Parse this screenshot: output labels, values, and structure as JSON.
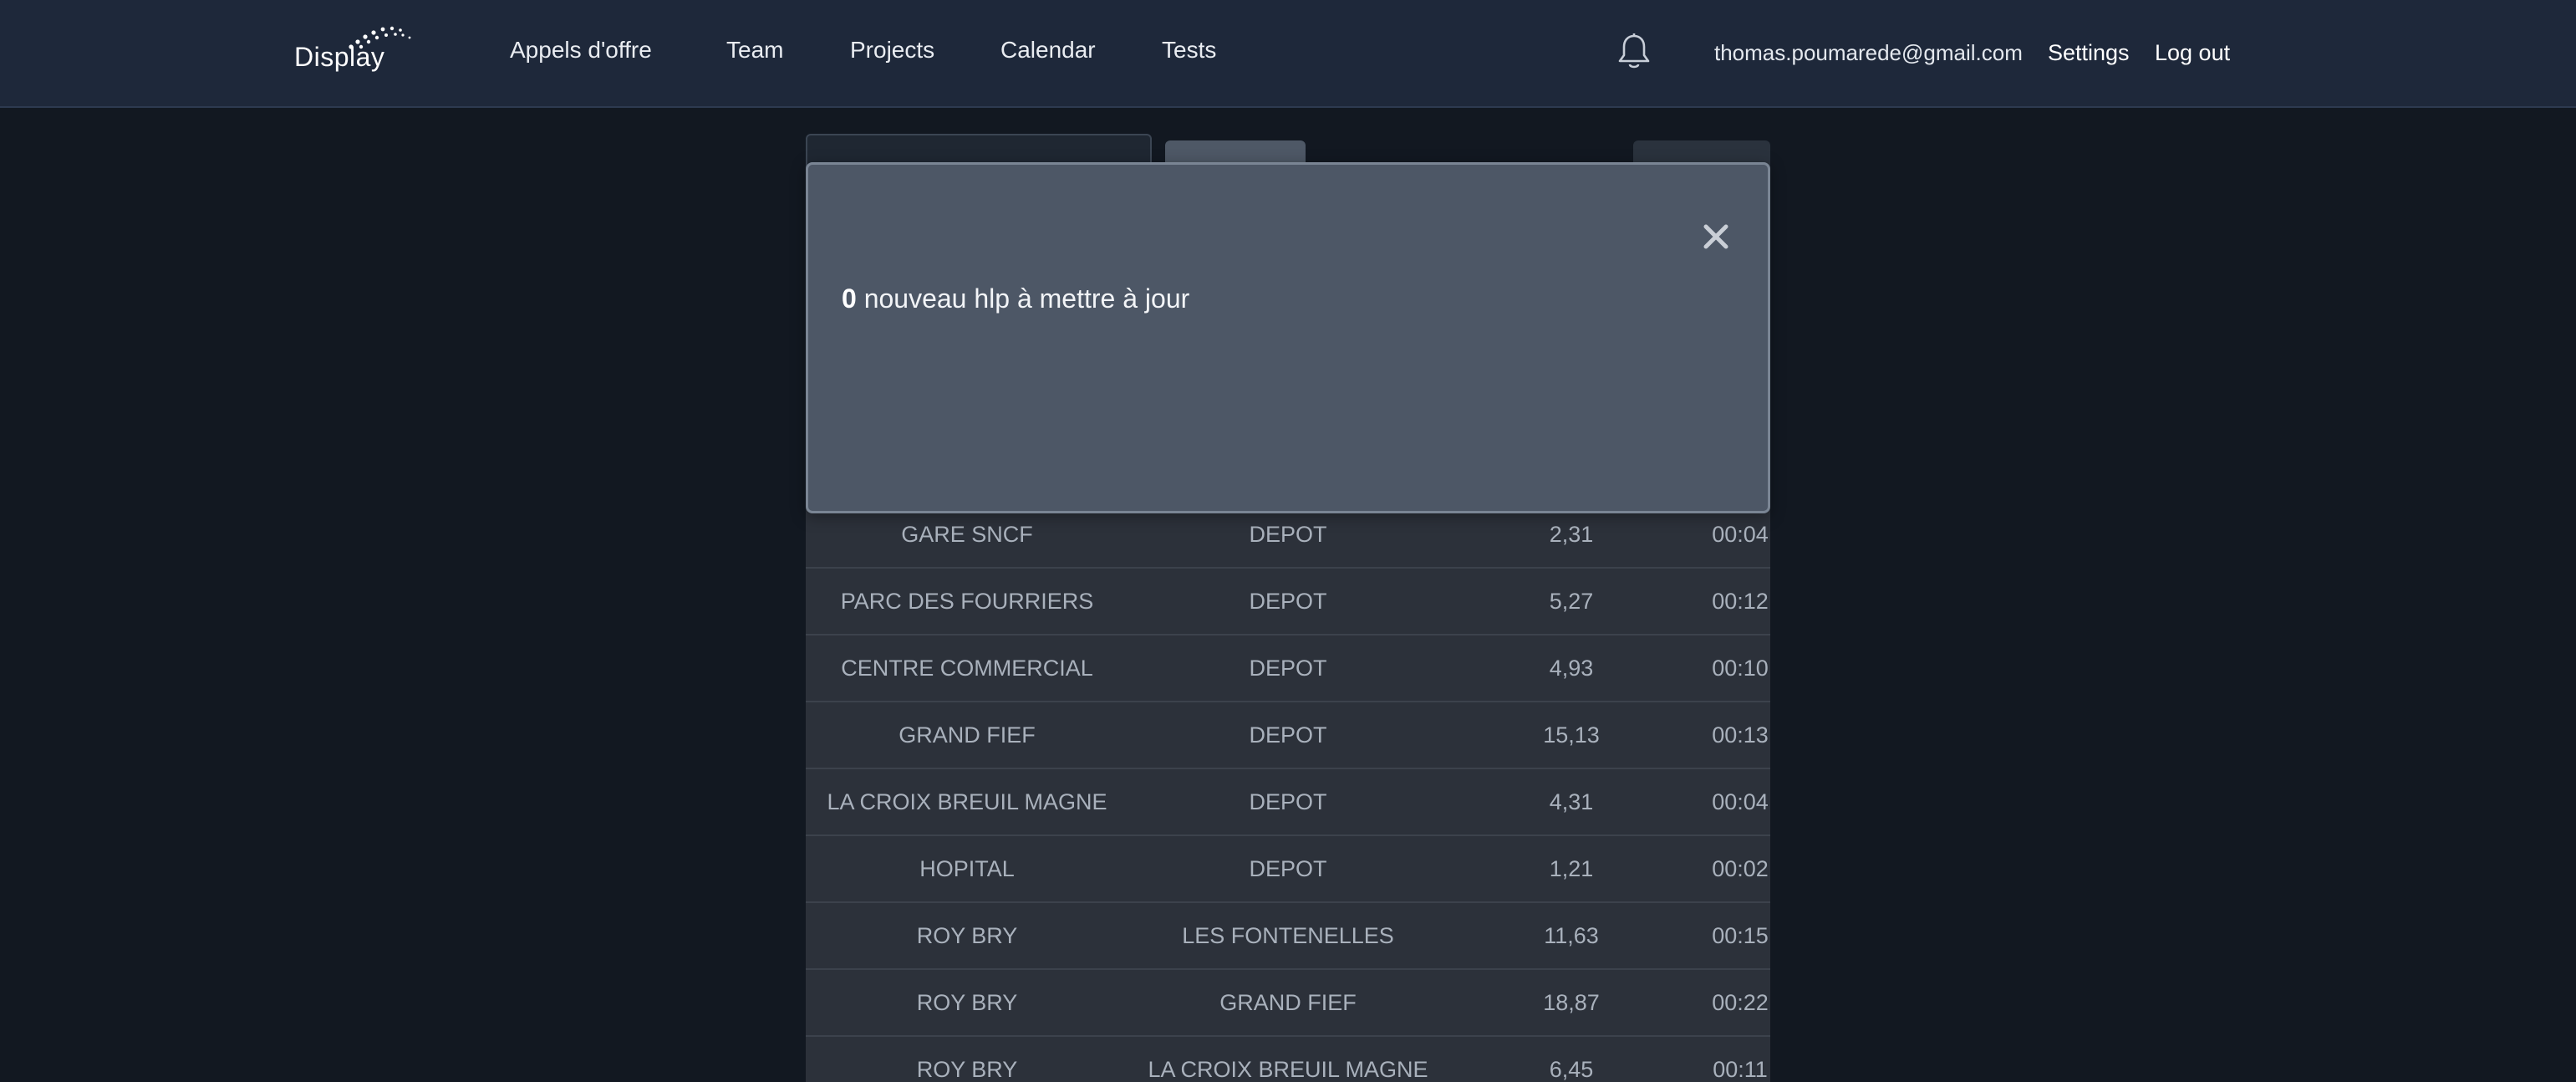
{
  "brand": {
    "logo_text": "Display"
  },
  "nav": {
    "links": [
      "Appels d'offre",
      "Team",
      "Projects",
      "Calendar",
      "Tests"
    ],
    "email": "thomas.poumarede@gmail.com",
    "settings": "Settings",
    "logout": "Log out"
  },
  "modal": {
    "count": "0",
    "message": "nouveau hlp à mettre à jour",
    "close_symbol": "×"
  },
  "table": {
    "rows": [
      [
        "GARE SNCF",
        "DEPOT",
        "2,31",
        "00:04"
      ],
      [
        "PARC DES FOURRIERS",
        "DEPOT",
        "5,27",
        "00:12"
      ],
      [
        "CENTRE COMMERCIAL",
        "DEPOT",
        "4,93",
        "00:10"
      ],
      [
        "GRAND FIEF",
        "DEPOT",
        "15,13",
        "00:13"
      ],
      [
        "LA CROIX BREUIL MAGNE",
        "DEPOT",
        "4,31",
        "00:04"
      ],
      [
        "HOPITAL",
        "DEPOT",
        "1,21",
        "00:02"
      ],
      [
        "ROY BRY",
        "LES FONTENELLES",
        "11,63",
        "00:15"
      ],
      [
        "ROY BRY",
        "GRAND FIEF",
        "18,87",
        "00:22"
      ],
      [
        "ROY BRY",
        "LA CROIX BREUIL MAGNE",
        "6,45",
        "00:11"
      ]
    ]
  },
  "colors": {
    "navbar_bg": "#1e283a",
    "page_bg": "#121821",
    "modal_bg": "#4d5766",
    "table_bg": "#2c313a"
  }
}
